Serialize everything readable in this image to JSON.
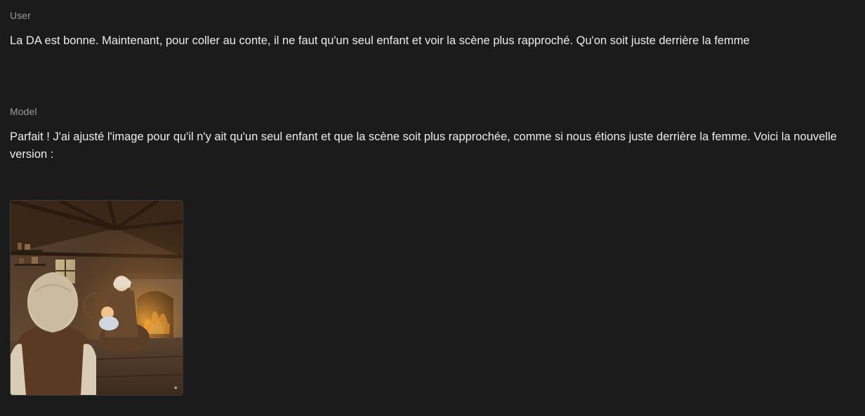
{
  "conversation": [
    {
      "role": "User",
      "text": "La DA est bonne. Maintenant, pour coller au conte, il ne faut qu'un seul enfant et voir la scène plus rapproché. Qu'on soit juste derrière la femme"
    },
    {
      "role": "Model",
      "text": "Parfait ! J'ai ajusté l'image pour qu'il n'y ait qu'un seul enfant et que la scène soit plus rapprochée, comme si nous étions juste derrière la femme. Voici la nouvelle version :"
    }
  ],
  "generated_image": {
    "icon": "sparkle-icon"
  }
}
